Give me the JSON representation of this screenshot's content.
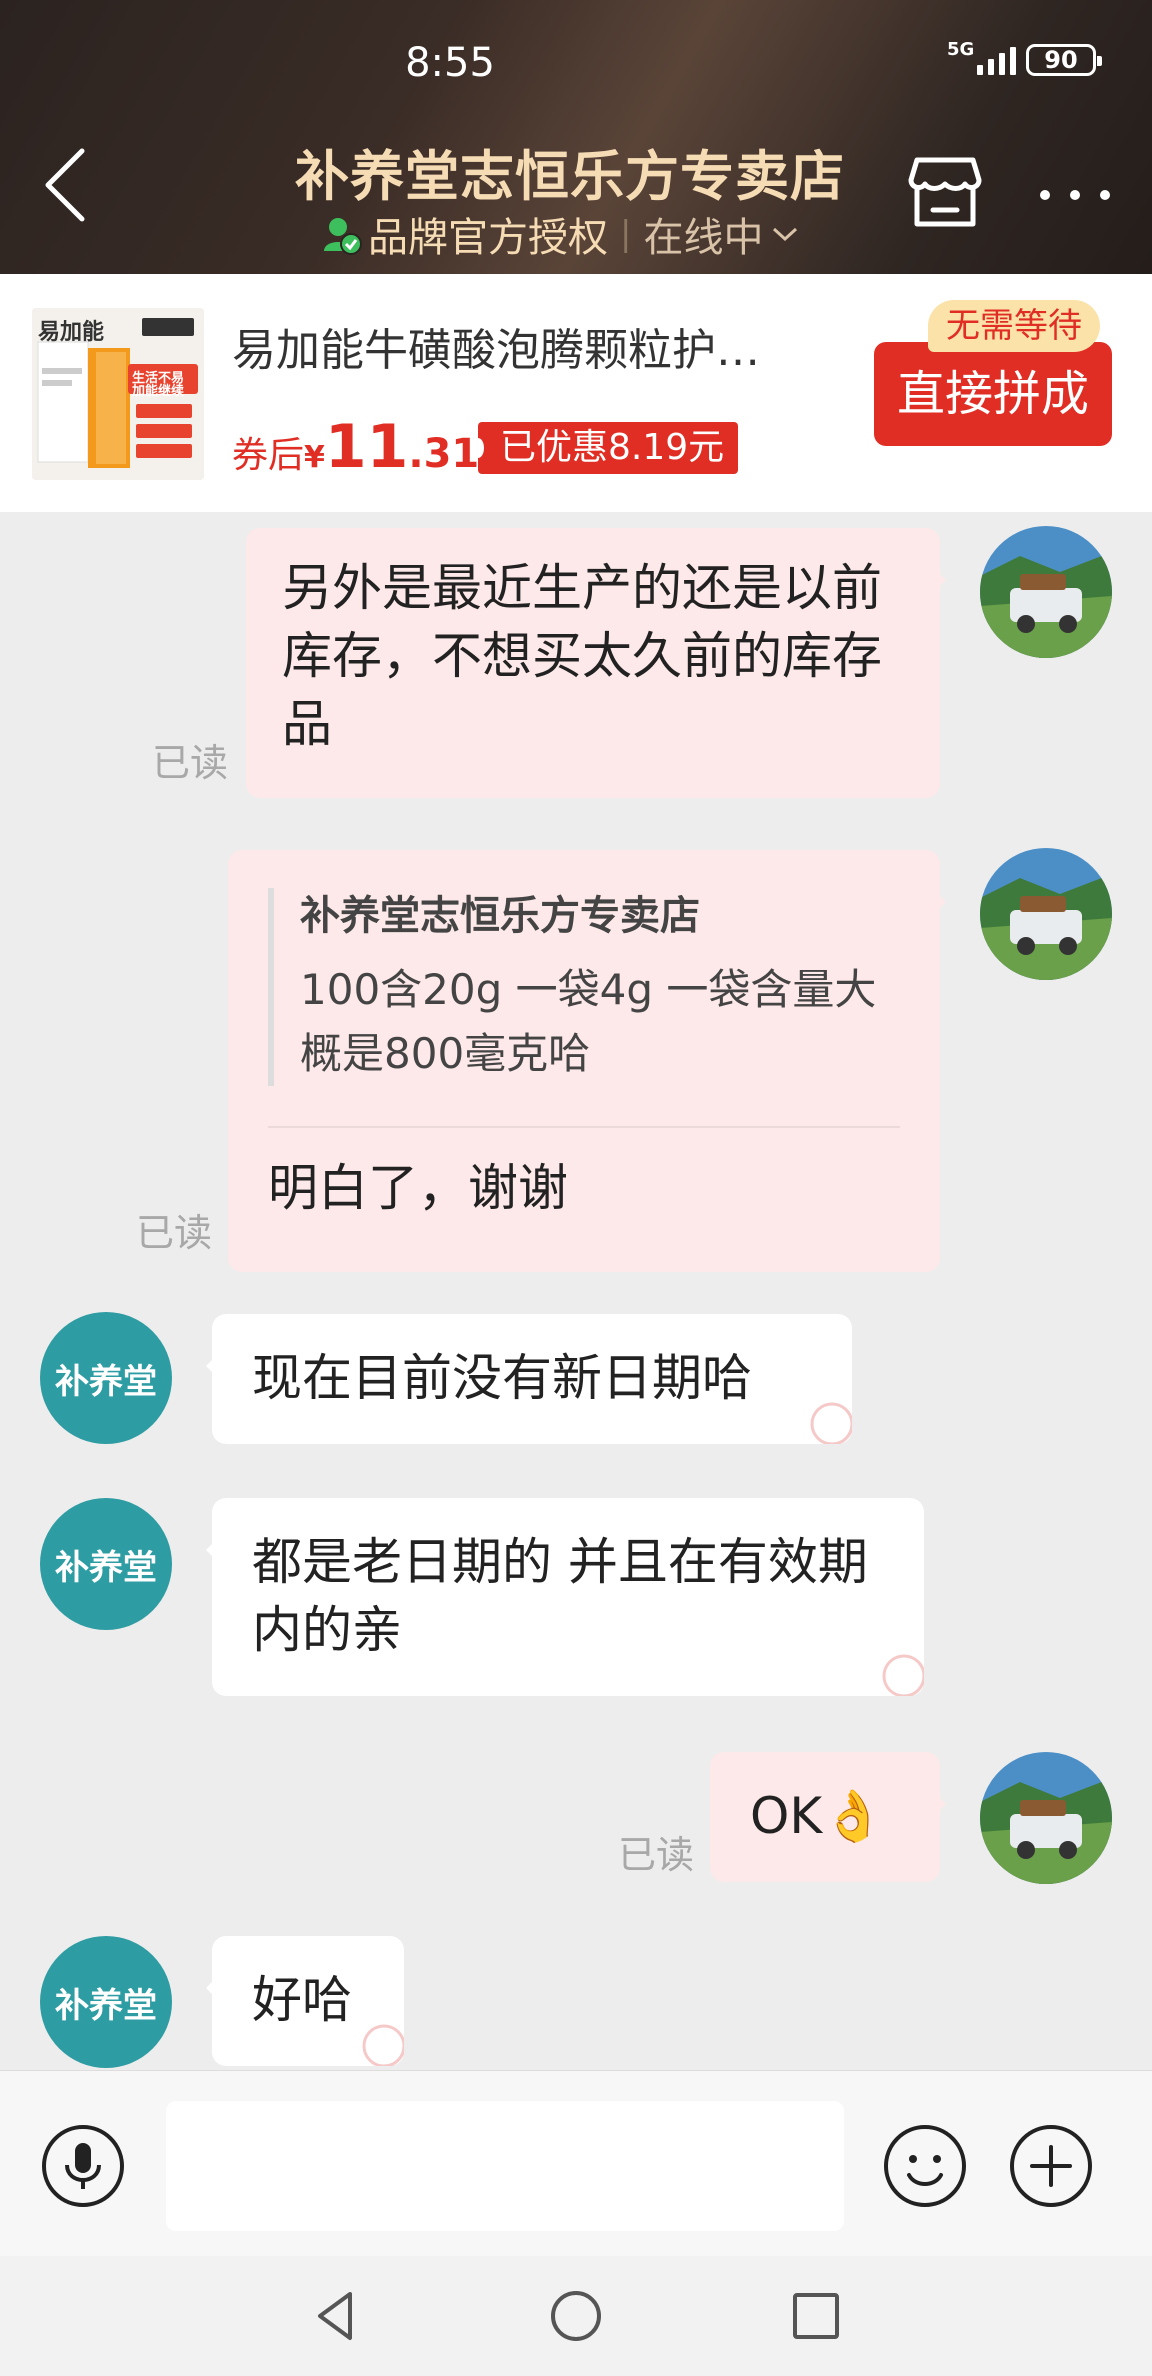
{
  "status_bar": {
    "time": "8:55",
    "network": "5G",
    "battery": "90"
  },
  "header": {
    "shop_name": "补养堂志恒乐方专卖店",
    "brand_label": "品牌官方授权",
    "online_status": "在线中"
  },
  "product": {
    "name": "易加能牛磺酸泡腾颗粒护…",
    "price_prefix": "券后",
    "currency": "¥",
    "price_int": "11",
    "price_dec": ".31",
    "discount": "已优惠8.19元",
    "wait_badge": "无需等待",
    "buy_button": "直接拼成",
    "thumb_brand": "易加能",
    "thumb_slogan_1": "生活不易",
    "thumb_slogan_2": "加能继续"
  },
  "messages": [
    {
      "sender": "me",
      "text": "另外是最近生产的还是以前库存，不想买太久前的库存品",
      "read": "已读"
    },
    {
      "sender": "me",
      "quote_title": "补养堂志恒乐方专卖店",
      "quote_text": "100含20g  一袋4g   一袋含量大概是800毫克哈",
      "text": "明白了，谢谢",
      "read": "已读"
    },
    {
      "sender": "shop",
      "avatar": "补养堂",
      "text": "现在目前没有新日期哈"
    },
    {
      "sender": "shop",
      "avatar": "补养堂",
      "text": "都是老日期的 并且在有效期内的亲"
    },
    {
      "sender": "me",
      "text": "OK👌",
      "read": "已读"
    },
    {
      "sender": "shop",
      "avatar": "补养堂",
      "text": "好哈"
    }
  ],
  "input": {
    "placeholder": ""
  },
  "colors": {
    "accent_red": "#e02e24",
    "shop_avatar": "#2e9ca3",
    "my_bubble": "#fde9e9",
    "header_gold": "#f6dcb4"
  }
}
